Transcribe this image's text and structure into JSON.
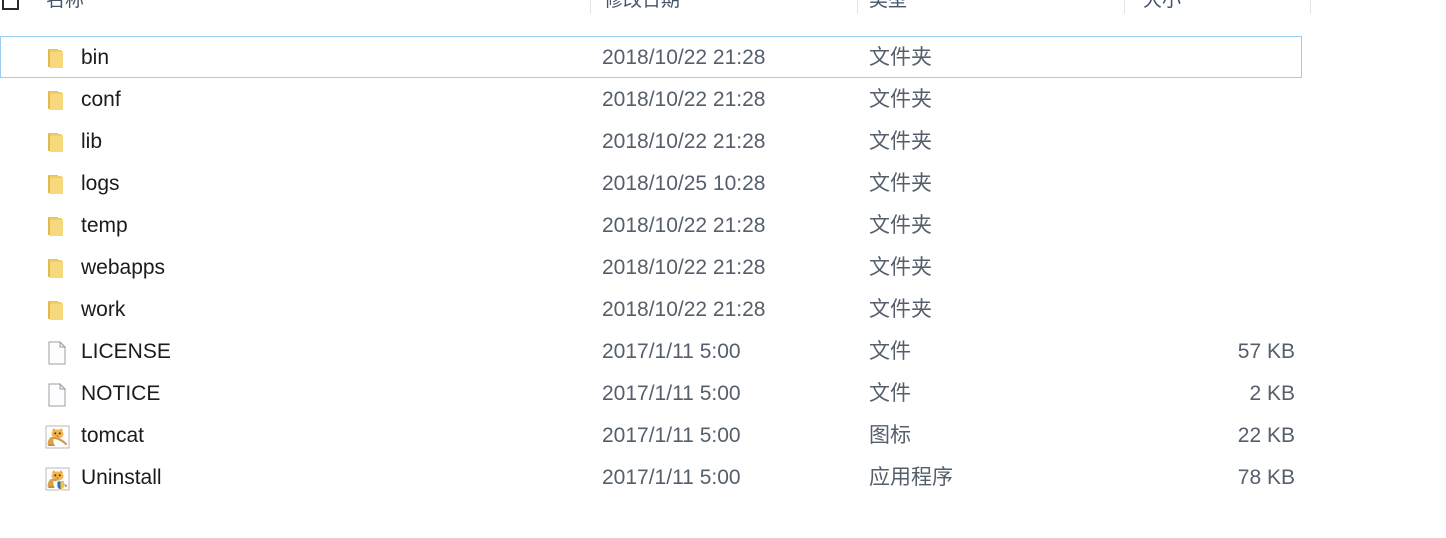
{
  "window": {
    "app": "Windows File Explorer",
    "view": "details-list"
  },
  "columns": {
    "select_all_checkbox": "",
    "name": "名称",
    "date_modified": "修改日期",
    "type": "类型",
    "size": "大小"
  },
  "colors": {
    "selection_border": "#9acdf0",
    "header_text": "#44546a",
    "row_text": "#1b1b1b",
    "secondary_text": "#555f6b",
    "folder_icon": "#f5d372",
    "background": "#ffffff"
  },
  "rows": [
    {
      "name": "bin",
      "date": "2018/10/22 21:28",
      "type": "文件夹",
      "size": "",
      "icon": "folder-icon",
      "selected": true
    },
    {
      "name": "conf",
      "date": "2018/10/22 21:28",
      "type": "文件夹",
      "size": "",
      "icon": "folder-icon",
      "selected": false
    },
    {
      "name": "lib",
      "date": "2018/10/22 21:28",
      "type": "文件夹",
      "size": "",
      "icon": "folder-icon",
      "selected": false
    },
    {
      "name": "logs",
      "date": "2018/10/25 10:28",
      "type": "文件夹",
      "size": "",
      "icon": "folder-icon",
      "selected": false
    },
    {
      "name": "temp",
      "date": "2018/10/22 21:28",
      "type": "文件夹",
      "size": "",
      "icon": "folder-icon",
      "selected": false
    },
    {
      "name": "webapps",
      "date": "2018/10/22 21:28",
      "type": "文件夹",
      "size": "",
      "icon": "folder-icon",
      "selected": false
    },
    {
      "name": "work",
      "date": "2018/10/22 21:28",
      "type": "文件夹",
      "size": "",
      "icon": "folder-icon",
      "selected": false
    },
    {
      "name": "LICENSE",
      "date": "2017/1/11 5:00",
      "type": "文件",
      "size": "57 KB",
      "icon": "document-icon",
      "selected": false
    },
    {
      "name": "NOTICE",
      "date": "2017/1/11 5:00",
      "type": "文件",
      "size": "2 KB",
      "icon": "document-icon",
      "selected": false
    },
    {
      "name": "tomcat",
      "date": "2017/1/11 5:00",
      "type": "图标",
      "size": "22 KB",
      "icon": "tomcat-cat-icon",
      "selected": false
    },
    {
      "name": "Uninstall",
      "date": "2017/1/11 5:00",
      "type": "应用程序",
      "size": "78 KB",
      "icon": "tomcat-cat-shield-icon",
      "selected": false
    }
  ]
}
